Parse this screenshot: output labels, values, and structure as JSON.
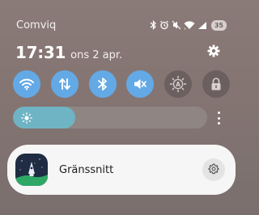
{
  "status_bar": {
    "carrier": "Comviq",
    "icons": [
      "bluetooth-icon",
      "alarm-icon",
      "mute-icon",
      "wifi-icon",
      "signal-icon"
    ],
    "battery": "35"
  },
  "header": {
    "time": "17:31",
    "date": "ons 2 apr.",
    "settings_icon": "gear-icon"
  },
  "quick_toggles": [
    {
      "name": "wifi",
      "icon": "wifi-icon",
      "state": "on"
    },
    {
      "name": "mobile-data",
      "icon": "data-transfer-icon",
      "state": "on"
    },
    {
      "name": "bluetooth",
      "icon": "bluetooth-icon",
      "state": "on"
    },
    {
      "name": "sound",
      "icon": "mute-icon",
      "state": "on"
    },
    {
      "name": "auto-brightness",
      "icon": "auto-brightness-icon",
      "state": "off"
    },
    {
      "name": "lock",
      "icon": "lock-icon",
      "state": "off"
    }
  ],
  "brightness": {
    "level": 0.32,
    "icon": "sun-icon"
  },
  "notification": {
    "app_name": "Gränssnitt",
    "icon": "app-icon",
    "settings_icon": "gear-icon"
  },
  "colors": {
    "toggle_on": "#63a9e6",
    "toggle_off": "#6b605f",
    "brightness_fill": "#6fb4c4",
    "card_bg": "#f6f6f6"
  }
}
